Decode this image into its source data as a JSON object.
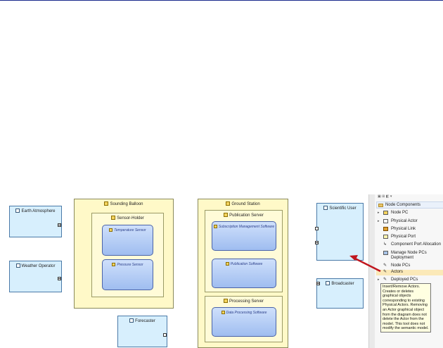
{
  "diagram": {
    "nodes": {
      "sounding_balloon": "Sounding Balloon",
      "sensor_holder": "Sensor-Holder",
      "ground_station": "Ground Station",
      "publication_server": "Publication Server",
      "processing_server": "Processing Server"
    },
    "components": {
      "temperature_sensor": "Temperature Sensor",
      "pressure_sensor": "Pressure Sensor",
      "subscription_mgmt": "Subscription Management Software",
      "publication_software": "Publication Software",
      "data_processing": "Data Processing Software"
    },
    "actors": {
      "earth_atmosphere": "Earth Atmosphere",
      "weather_operator": "Weather Operator",
      "forecaster": "Forecaster",
      "scientific_user": "Scientific User",
      "broadcaster": "Broadcaster"
    }
  },
  "palette": {
    "header": "Node Components",
    "items": [
      {
        "label": "Node PC",
        "icon": "node-pc-icon"
      },
      {
        "label": "Physical Actor",
        "icon": "physical-actor-icon"
      },
      {
        "label": "Physical Link",
        "icon": "physical-link-icon"
      },
      {
        "label": "Physical Port",
        "icon": "physical-port-icon"
      },
      {
        "label": "Component Port Allocation",
        "icon": "port-allocation-icon"
      },
      {
        "label": "Manage Node PCs Deployment",
        "icon": "manage-deployment-icon"
      },
      {
        "label": "Node PCs",
        "icon": "node-pcs-icon"
      },
      {
        "label": "Actors",
        "icon": "actors-icon"
      },
      {
        "label": "Deployed PCs",
        "icon": "deployed-pcs-icon"
      }
    ]
  },
  "tooltip": {
    "title": "Insert/Remove Actors.",
    "body": "Creates or deletes graphical objects corresponding to existing Physical Actors. Removing an Actor graphical object from the diagram does not delete the Actor from the model. This tool does not modify the semantic model."
  },
  "colors": {
    "node_fill": "#fff9c8",
    "actor_fill": "#d7effd",
    "component_fill": "#b7cff6",
    "arrow": "#c0161e"
  }
}
